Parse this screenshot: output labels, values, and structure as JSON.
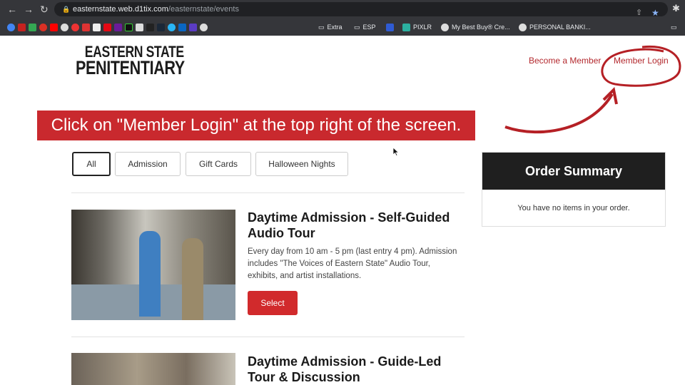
{
  "browser": {
    "url_host": "easternstate.web.d1tix.com",
    "url_path": "/easternstate/events",
    "bookmarks": [
      "Extra",
      "ESP",
      "PIXLR",
      "My Best Buy® Cre...",
      "PERSONAL BANKI..."
    ]
  },
  "header": {
    "logo_line1": "Eastern State",
    "logo_line2": "Penitentiary",
    "become_member": "Become a Member",
    "member_login": "Member Login"
  },
  "banner": {
    "text": "Click on \"Member Login\" at the top right of the screen."
  },
  "filters": [
    "All",
    "Admission",
    "Gift Cards",
    "Halloween Nights"
  ],
  "events": [
    {
      "title": "Daytime Admission - Self-Guided Audio Tour",
      "description": "Every day from 10 am - 5 pm (last entry 4 pm). Admission includes \"The Voices of Eastern State\" Audio Tour, exhibits, and artist installations.",
      "button": "Select"
    },
    {
      "title": "Daytime Admission - Guide-Led Tour & Discussion"
    }
  ],
  "order_summary": {
    "title": "Order Summary",
    "empty": "You have no items in your order."
  },
  "colors": {
    "brand_red": "#c9292e",
    "dark": "#1f1f1f"
  }
}
